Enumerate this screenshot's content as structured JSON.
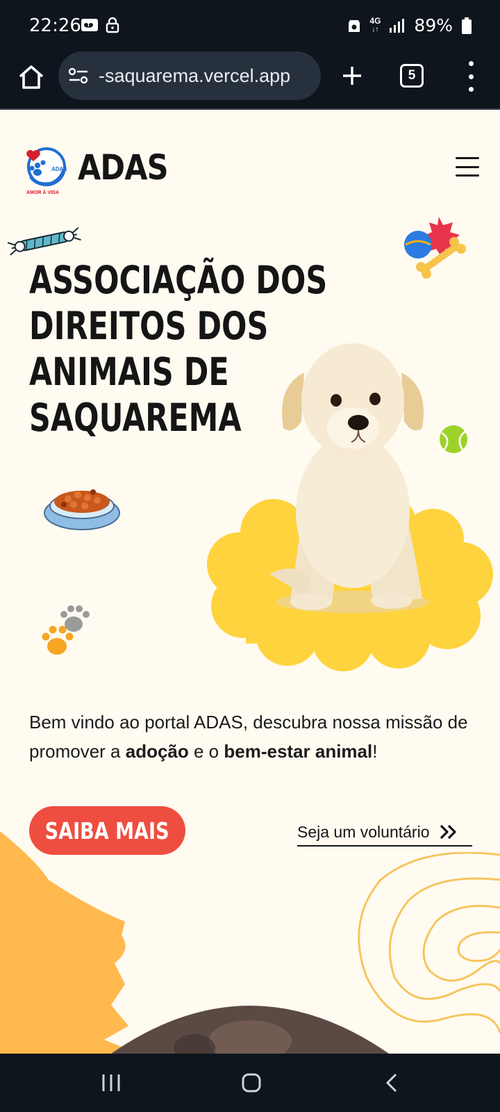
{
  "status_bar": {
    "time": "22:26",
    "network": "4G",
    "battery_percent": "89%",
    "battery_level": 0.89
  },
  "browser": {
    "url": "-saquarema.vercel.app",
    "tab_count": "5",
    "icons": [
      "home-icon",
      "site-settings-icon",
      "plus-icon",
      "tabs-icon",
      "menu-icon"
    ]
  },
  "header": {
    "logo_alt_text": "ADAS AMOR À VIDA",
    "brand": "ADAS",
    "menu_icon": "hamburger-icon"
  },
  "hero": {
    "title_lines": [
      "ASSOCIAÇÃO DOS",
      "DIREITOS DOS",
      "ANIMAIS DE",
      "SAQUAREMA"
    ],
    "intro_prefix": "Bem vindo ao portal ADAS, descubra nossa missão de promover a ",
    "intro_bold_1": "adoção",
    "intro_middle": " e o ",
    "intro_bold_2": "bem-estar animal",
    "intro_suffix": "!",
    "cta_primary": "SAIBA MAIS",
    "cta_secondary": "Seja um voluntário"
  },
  "colors": {
    "background": "#fffbf1",
    "accent_red": "#ee4e3f",
    "accent_yellow": "#ffd33d",
    "accent_orange": "#ffb94e",
    "dark_bar": "#0e151d"
  },
  "nav": {
    "icons": [
      "recent-apps-icon",
      "home-nav-icon",
      "back-icon"
    ]
  }
}
